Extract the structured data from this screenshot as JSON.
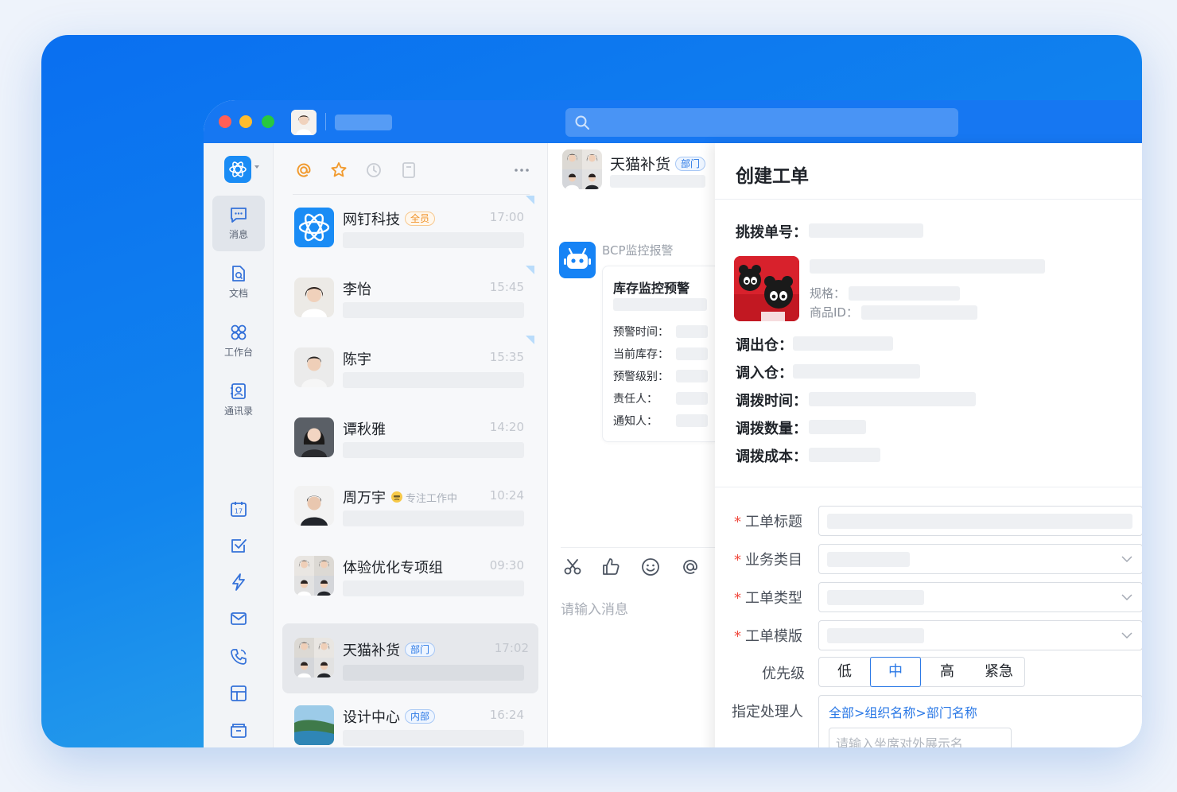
{
  "colors": {
    "brand": "#1677f2",
    "accent": "#2b79e6",
    "required": "#f04a3e"
  },
  "rail": {
    "items": [
      {
        "label": "消息",
        "icon": "message-icon"
      },
      {
        "label": "文档",
        "icon": "document-icon"
      },
      {
        "label": "工作台",
        "icon": "workbench-icon"
      },
      {
        "label": "通讯录",
        "icon": "contacts-icon"
      }
    ],
    "calendar_day": "17"
  },
  "conversations": [
    {
      "name": "网钉科技",
      "tag": "全员",
      "time": "17:00"
    },
    {
      "name": "李怡",
      "time": "15:45"
    },
    {
      "name": "陈宇",
      "time": "15:35"
    },
    {
      "name": "谭秋雅",
      "time": "14:20"
    },
    {
      "name": "周万宇",
      "status": "专注工作中",
      "time": "10:24"
    },
    {
      "name": "体验优化专项组",
      "time": "09:30"
    },
    {
      "name": "天猫补货",
      "tag": "部门",
      "time": "17:02"
    },
    {
      "name": "设计中心",
      "tag": "内部",
      "time": "16:24"
    }
  ],
  "chat": {
    "title": "天猫补货",
    "tag": "部门",
    "bot_name": "BCP监控报警",
    "card": {
      "title": "库存监控预警",
      "rows": [
        "预警时间：",
        "当前库存：",
        "预警级别：",
        "责任人：",
        "通知人："
      ]
    },
    "input_placeholder": "请输入消息"
  },
  "panel": {
    "title": "创建工单",
    "transfer_no_label": "挑拨单号：",
    "spec_label": "规格：",
    "product_id_label": "商品ID：",
    "out_wh_label": "调出仓：",
    "in_wh_label": "调入仓：",
    "time_label": "调拨时间：",
    "qty_label": "调拨数量：",
    "cost_label": "调拨成本：",
    "form": {
      "req_mark": "*",
      "ticket_title": "工单标题",
      "category": "业务类目",
      "ticket_type": "工单类型",
      "template": "工单模版",
      "priority": "优先级",
      "priority_options": [
        "低",
        "中",
        "高",
        "紧急"
      ],
      "assignee": "指定处理人",
      "assignee_path": "全部>组织名称>部门名称",
      "assignee_placeholder": "请输入坐席对外展示名"
    }
  }
}
